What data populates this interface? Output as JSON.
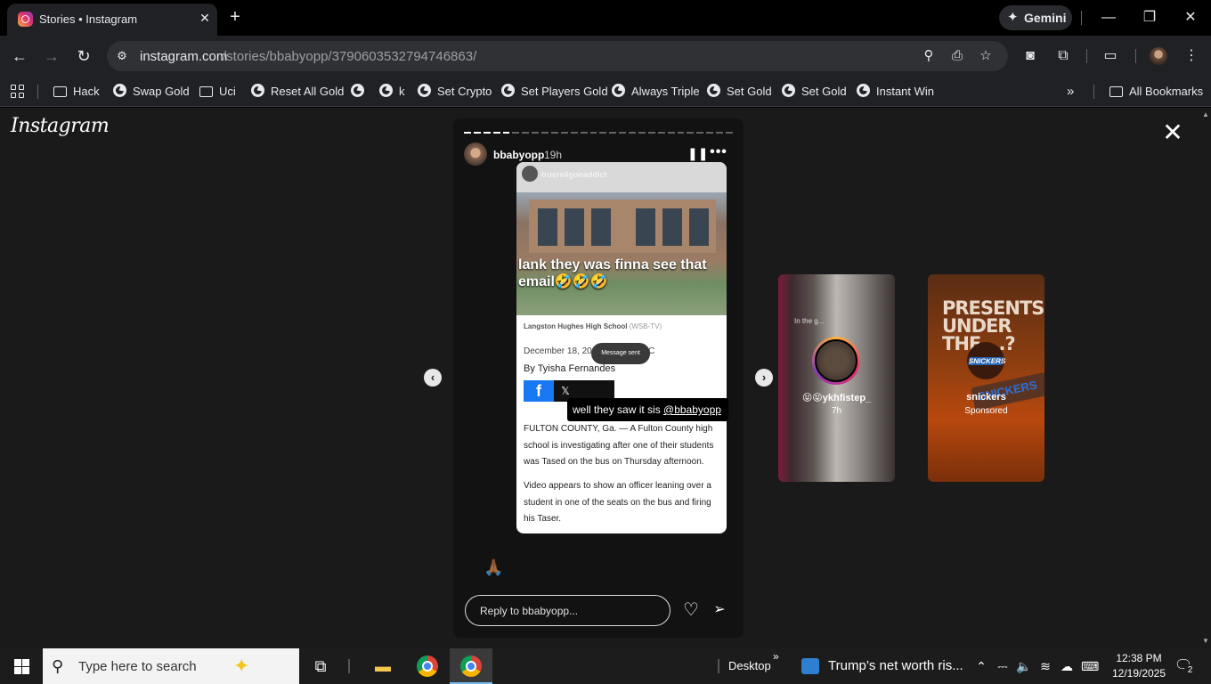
{
  "browser": {
    "tab_title": "Stories • Instagram",
    "gemini_label": "Gemini",
    "url_host": "instagram.com",
    "url_path": "/stories/bbabyopp/3790603532794746863/"
  },
  "bookmarks": [
    {
      "label": "Hack",
      "icon": "folder-icon"
    },
    {
      "label": "Swap Gold",
      "icon": "globe-icon"
    },
    {
      "label": "Uci",
      "icon": "folder-icon"
    },
    {
      "label": "Reset All Gold",
      "icon": "globe-icon"
    },
    {
      "label": "",
      "icon": "globe-icon"
    },
    {
      "label": "k",
      "icon": "globe-icon"
    },
    {
      "label": "Set Crypto",
      "icon": "globe-icon"
    },
    {
      "label": "Set Players Gold",
      "icon": "globe-icon"
    },
    {
      "label": "Always Triple",
      "icon": "globe-icon"
    },
    {
      "label": "Set Gold",
      "icon": "globe-icon"
    },
    {
      "label": "Set Gold",
      "icon": "globe-icon"
    },
    {
      "label": "Instant Win",
      "icon": "globe-icon"
    }
  ],
  "all_bookmarks": "All Bookmarks",
  "instagram": {
    "logo": "Instagram",
    "story": {
      "username": "bbabyopp",
      "time": "19h",
      "progress": {
        "segments": 28,
        "viewed": 5
      },
      "embedded": {
        "source_user": "truereligonaddict",
        "caption": "lank they was finna see that email🤣🤣🤣",
        "photo_caption": "Langston Hughes High School",
        "photo_source": "(WSB-TV)",
        "date": "December 18, 202",
        "date_suffix": "TC",
        "message_sent": "Message sent",
        "byline": "By Tyisha Fernandes",
        "paragraph1": "FULTON COUNTY, Ga. — A Fulton County high school is investigating after one of their students was Tased on the bus on Thursday afternoon.",
        "paragraph2": "Video appears to show an officer leaning over a student in one of the seats on the bus and firing his Taser."
      },
      "sticker_text": "well they saw it sis ",
      "sticker_mention": "@bbabyopp",
      "reaction_emoji": "🙏🏾",
      "reply_placeholder": "Reply to bbabyopp..."
    },
    "previews": [
      {
        "name": "😝😝ykhfistep_",
        "sub": "7h",
        "overlay": "In the g..."
      },
      {
        "name": "snickers",
        "sub": "Sponsored",
        "ad_text": "PRESENTS UNDER THE ...?",
        "logo": "SNICKERS"
      }
    ]
  },
  "taskbar": {
    "search_placeholder": "Type here to search",
    "desktop_label": "Desktop",
    "news_text": "Trump’s net worth ris...",
    "time": "12:38 PM",
    "date": "12/19/2025",
    "notification_count": "2"
  }
}
